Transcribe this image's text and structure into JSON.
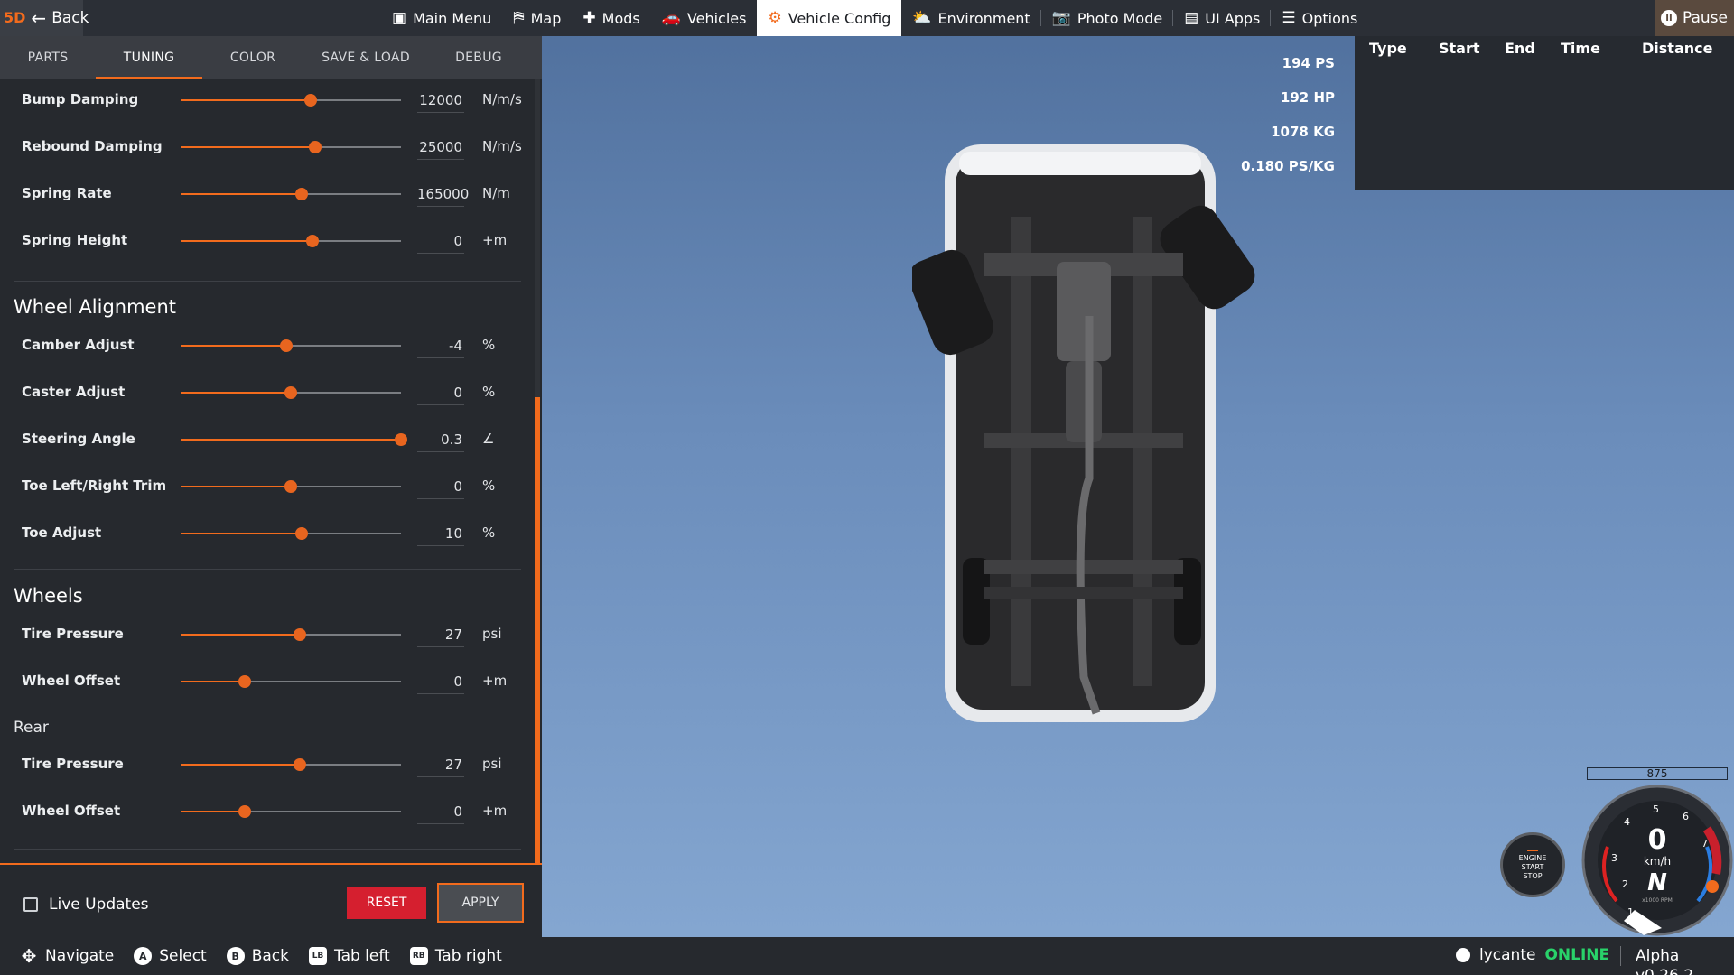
{
  "topbar": {
    "back_label": "Back",
    "logo_text": "5D",
    "menu": [
      {
        "label": "Main Menu",
        "icon": "grid-plus-icon",
        "glyph": "▣"
      },
      {
        "label": "Map",
        "icon": "map-icon",
        "glyph": "⛿"
      },
      {
        "label": "Mods",
        "icon": "puzzle-icon",
        "glyph": "✚"
      },
      {
        "label": "Vehicles",
        "icon": "car-icon",
        "glyph": "🚗"
      },
      {
        "label": "Vehicle Config",
        "icon": "engine-icon",
        "glyph": "⚙",
        "active": true
      },
      {
        "label": "Environment",
        "icon": "weather-icon",
        "glyph": "⛅"
      },
      {
        "label": "Photo Mode",
        "icon": "camera-icon",
        "glyph": "📷"
      },
      {
        "label": "UI Apps",
        "icon": "apps-icon",
        "glyph": "▤"
      },
      {
        "label": "Options",
        "icon": "sliders-icon",
        "glyph": "☰"
      }
    ],
    "pause_label": "Pause"
  },
  "tabs": [
    "PARTS",
    "TUNING",
    "COLOR",
    "SAVE & LOAD",
    "DEBUG"
  ],
  "active_tab": "TUNING",
  "suspension_rows": [
    {
      "label": "Bump Damping",
      "value": "12000",
      "unit": "N/m/s",
      "level": 0.59
    },
    {
      "label": "Rebound Damping",
      "value": "25000",
      "unit": "N/m/s",
      "level": 0.61
    },
    {
      "label": "Spring Rate",
      "value": "165000",
      "unit": "N/m",
      "level": 0.55
    },
    {
      "label": "Spring Height",
      "value": "0",
      "unit": "+m",
      "level": 0.6
    }
  ],
  "wheel_alignment": {
    "title": "Wheel Alignment",
    "rows": [
      {
        "label": "Camber Adjust",
        "value": "-4",
        "unit": "%",
        "level": 0.48
      },
      {
        "label": "Caster Adjust",
        "value": "0",
        "unit": "%",
        "level": 0.5
      },
      {
        "label": "Steering Angle",
        "value": "0.3",
        "unit": "∠",
        "level": 1.0
      },
      {
        "label": "Toe Left/Right Trim",
        "value": "0",
        "unit": "%",
        "level": 0.5
      },
      {
        "label": "Toe Adjust",
        "value": "10",
        "unit": "%",
        "level": 0.55
      }
    ]
  },
  "wheels": {
    "title": "Wheels",
    "rows": [
      {
        "label": "Tire Pressure",
        "value": "27",
        "unit": "psi",
        "level": 0.54
      },
      {
        "label": "Wheel Offset",
        "value": "0",
        "unit": "+m",
        "level": 0.29
      }
    ],
    "rear_title": "Rear",
    "rear_rows": [
      {
        "label": "Tire Pressure",
        "value": "27",
        "unit": "psi",
        "level": 0.54
      },
      {
        "label": "Wheel Offset",
        "value": "0",
        "unit": "+m",
        "level": 0.29
      }
    ]
  },
  "footer": {
    "live_updates_label": "Live Updates",
    "reset_label": "RESET",
    "apply_label": "APPLY"
  },
  "stats": [
    "194 PS",
    "192 HP",
    "1078 KG",
    "0.180 PS/KG"
  ],
  "timing_table": {
    "headers": [
      "Type",
      "Start",
      "End",
      "Time",
      "Distance"
    ]
  },
  "dashboard": {
    "rpm_readout": "875",
    "start_stop_lines": [
      "ENGINE",
      "START",
      "STOP"
    ],
    "speed": "0",
    "speed_unit": "km/h",
    "gear": "N",
    "rpm_scale_label": "x1000 RPM",
    "gauge_ticks": [
      "1",
      "2",
      "3",
      "4",
      "5",
      "6",
      "7"
    ],
    "accent_color": "#f26b1d"
  },
  "bottombar": {
    "hints": [
      {
        "button": "✥",
        "label": "Navigate",
        "icon": "dpad-icon"
      },
      {
        "button": "A",
        "label": "Select",
        "icon": "a-button-icon"
      },
      {
        "button": "B",
        "label": "Back",
        "icon": "b-button-icon"
      },
      {
        "button": "LB",
        "label": "Tab left",
        "icon": "lb-button-icon"
      },
      {
        "button": "RB",
        "label": "Tab right",
        "icon": "rb-button-icon"
      }
    ],
    "username": "lycante",
    "status": "ONLINE",
    "version": "Alpha v0.26.2"
  }
}
